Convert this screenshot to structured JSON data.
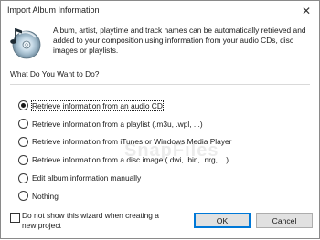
{
  "window": {
    "title": "Import Album Information",
    "close_glyph": "✕"
  },
  "intro_text": "Album, artist, playtime and track names can be automatically retrieved and added to your composition using information from your audio CDs, disc images or playlists.",
  "question": "What Do You Want to Do?",
  "options": [
    {
      "label": "Retrieve information from an audio CD",
      "selected": true
    },
    {
      "label": "Retrieve information from a playlist (.m3u, .wpl, ...)",
      "selected": false
    },
    {
      "label": "Retrieve information from iTunes or Windows Media Player",
      "selected": false
    },
    {
      "label": "Retrieve information from a disc image (.dwi, .bin, .nrg, ...)",
      "selected": false
    },
    {
      "label": "Edit album information manually",
      "selected": false
    },
    {
      "label": "Nothing",
      "selected": false
    }
  ],
  "watermark": "SnapFiles",
  "footer": {
    "checkbox_label": "Do not show this wizard when creating a new project",
    "checkbox_checked": false,
    "ok_label": "OK",
    "cancel_label": "Cancel"
  },
  "icons": {
    "app_icon": "cd-with-music-note-icon",
    "close": "close-icon"
  }
}
